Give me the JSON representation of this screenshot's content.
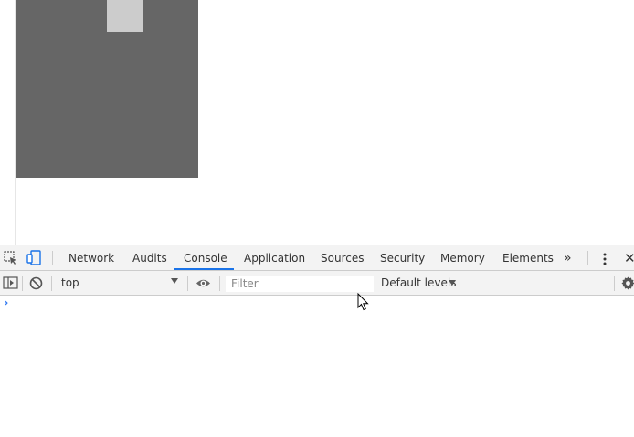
{
  "devtools": {
    "tabs": [
      {
        "label": "Network"
      },
      {
        "label": "Audits"
      },
      {
        "label": "Console"
      },
      {
        "label": "Application"
      },
      {
        "label": "Sources"
      },
      {
        "label": "Security"
      },
      {
        "label": "Memory"
      },
      {
        "label": "Elements"
      }
    ],
    "active_tab": "Console",
    "more_tabs_glyph": "»",
    "close_glyph": "✕"
  },
  "console_toolbar": {
    "context": "top",
    "filter_placeholder": "Filter",
    "filter_value": "",
    "levels_label": "Default levels"
  },
  "console": {
    "prompt_glyph": "›"
  },
  "colors": {
    "accent": "#1a73e8",
    "page_gray": "#666666",
    "page_light": "#cccccc",
    "prompt": "#367cf1"
  }
}
